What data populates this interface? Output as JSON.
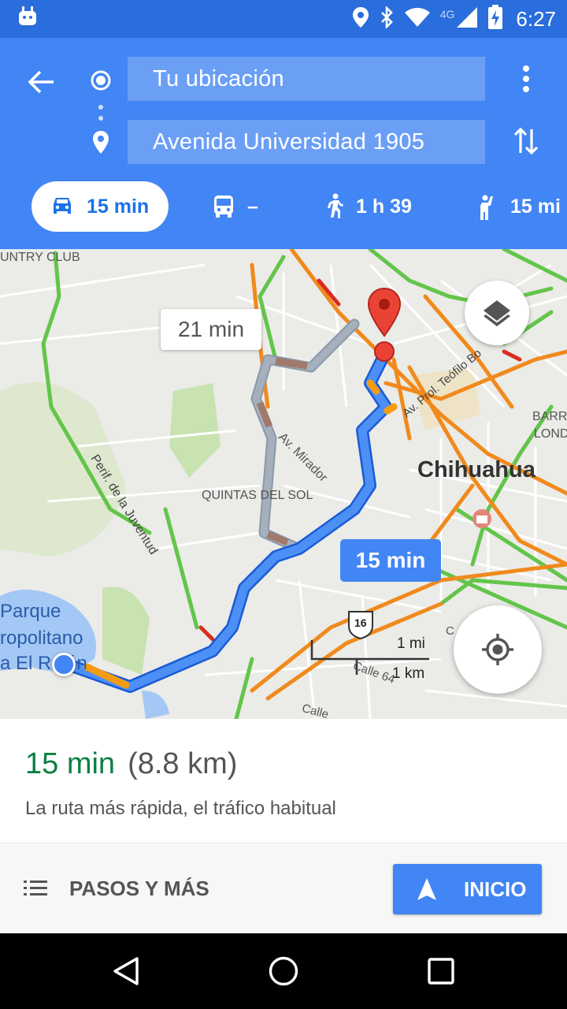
{
  "status_bar": {
    "time": "6:27",
    "network": "4G",
    "icons": [
      "android-icon",
      "location-icon",
      "bluetooth-icon",
      "wifi-icon",
      "signal-icon",
      "battery-charging-icon"
    ]
  },
  "header": {
    "origin_value": "Tu ubicación",
    "destination_value": "Avenida Universidad 1905",
    "modes": [
      {
        "name": "car",
        "label": "15 min",
        "active": true
      },
      {
        "name": "transit",
        "label": "–",
        "active": false
      },
      {
        "name": "walk",
        "label": "1 h 39",
        "active": false
      },
      {
        "name": "ride",
        "label": "15 mi",
        "active": false
      }
    ]
  },
  "map": {
    "labels": {
      "country_club": "UNTRY CLUB",
      "av_mirador": "Av. Mirador",
      "quintas": "QUINTAS DEL SOL",
      "chihuahua": "Chihuahua",
      "perif": "Perif. de la Juventud",
      "parque_1": "Parque",
      "parque_2": "ropolitano",
      "parque_3": "a El Rejón",
      "av_prol": "Av. Prol. Teófilo Bo",
      "barr": "BARR",
      "lond": "LOND",
      "calle64": "Calle 64",
      "calle": "Calle",
      "c": "C",
      "highway": "16"
    },
    "alt_route_time": "21 min",
    "main_route_time": "15 min",
    "scale_mi": "1 mi",
    "scale_km": "1 km"
  },
  "summary": {
    "time": "15 min",
    "distance": "(8.8 km)",
    "description": "La ruta más rápida, el tráfico habitual"
  },
  "actions": {
    "steps_label": "PASOS Y MÁS",
    "start_label": "INICIO"
  },
  "colors": {
    "header_blue": "#4285f4",
    "status_blue": "#2a6ddc",
    "route_blue": "#4285f4",
    "alt_route_gray": "#9aa5b1",
    "traffic_green": "#63c54a",
    "traffic_orange": "#f08a1c",
    "traffic_red": "#d92d20",
    "eta_green": "#0b8043"
  }
}
